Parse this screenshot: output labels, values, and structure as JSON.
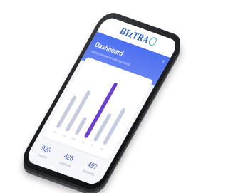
{
  "app": {
    "logo_text": "BizTRA"
  },
  "header": {
    "title": "Dashboard",
    "subtitle": "Weekly overview of tasks and activity",
    "back_icon": "chevron-left-icon",
    "menu_icon": "menu-icon"
  },
  "chart_data": {
    "type": "bar",
    "categories": [
      "Mon",
      "Tue",
      "Wed",
      "Thu",
      "Fri",
      "Sat"
    ],
    "values": [
      55,
      70,
      30,
      95,
      48,
      62
    ],
    "highlight_index": 3,
    "ylim": [
      0,
      100
    ],
    "colors": {
      "bar": "#c7cbe0",
      "active": "#6b3fcf"
    }
  },
  "stats": [
    {
      "value": "923",
      "label": "Created"
    },
    {
      "value": "426",
      "label": "Completed"
    },
    {
      "value": "497",
      "label": "Remaining"
    }
  ],
  "colors": {
    "accent": "#4b6ff0",
    "logo": "#2f62c4"
  }
}
